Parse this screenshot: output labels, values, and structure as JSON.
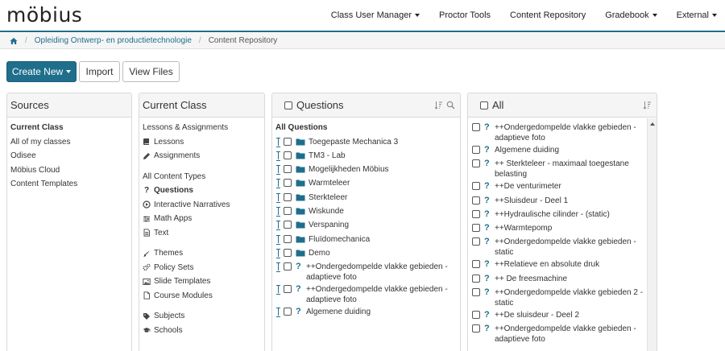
{
  "navbar": {
    "logo": "möbius",
    "items": [
      {
        "label": "Class User Manager",
        "dropdown": true
      },
      {
        "label": "Proctor Tools",
        "dropdown": false
      },
      {
        "label": "Content Repository",
        "dropdown": false
      },
      {
        "label": "Gradebook",
        "dropdown": true
      },
      {
        "label": "External",
        "dropdown": true
      }
    ]
  },
  "breadcrumb": {
    "home_icon": "home-icon",
    "course": "Opleiding Ontwerp- en productietechnologie",
    "current": "Content Repository"
  },
  "toolbar": {
    "create_new": "Create New",
    "import": "Import",
    "view_files": "View Files"
  },
  "sources": {
    "title": "Sources",
    "items": [
      "Current Class",
      "All of my classes",
      "Odisee",
      "Möbius Cloud",
      "Content Templates"
    ]
  },
  "current_class": {
    "title": "Current Class",
    "lessons_header": "Lessons & Assignments",
    "lessons": [
      {
        "label": "Lessons",
        "icon": "book-icon"
      },
      {
        "label": "Assignments",
        "icon": "pencil-icon"
      }
    ],
    "types_header": "All Content Types",
    "types": [
      {
        "label": "Questions",
        "icon": "question-icon"
      },
      {
        "label": "Interactive Narratives",
        "icon": "play-circle-icon"
      },
      {
        "label": "Math Apps",
        "icon": "sliders-icon"
      },
      {
        "label": "Text",
        "icon": "file-text-icon"
      }
    ],
    "misc": [
      {
        "label": "Themes",
        "icon": "brush-icon"
      },
      {
        "label": "Policy Sets",
        "icon": "gears-icon"
      },
      {
        "label": "Slide Templates",
        "icon": "image-icon"
      },
      {
        "label": "Course Modules",
        "icon": "document-icon"
      }
    ],
    "other": [
      {
        "label": "Subjects",
        "icon": "tag-icon"
      },
      {
        "label": "Schools",
        "icon": "graduation-cap-icon"
      }
    ]
  },
  "questions": {
    "title": "Questions",
    "header": "All Questions",
    "folders": [
      "Toegepaste Mechanica 3",
      "TM3 - Lab",
      "Mogelijkheden Möbius",
      "Warmteleer",
      "Sterkteleer",
      "Wiskunde",
      "Verspaning",
      "Fluïdomechanica",
      "Demo"
    ],
    "items": [
      "++Ondergedompelde vlakke gebieden - adaptieve foto",
      "++Ondergedompelde vlakke gebieden - adaptieve foto",
      "Algemene duiding"
    ]
  },
  "all": {
    "title": "All",
    "items": [
      "++Ondergedompelde vlakke gebieden - adaptieve foto",
      "Algemene duiding",
      "++ Sterkteleer - maximaal toegestane belasting",
      "++De venturimeter",
      "++Sluisdeur - Deel 1",
      "++Hydraulische cilinder - (static)",
      "++Warmtepomp",
      "++Ondergedompelde vlakke gebieden - static",
      "++Relatieve en absolute druk",
      "++ De freesmachine",
      "++Ondergedompelde vlakke gebieden 2 - static",
      "++De sluisdeur - Deel 2",
      "++Ondergedompelde vlakke gebieden - adaptieve foto"
    ]
  },
  "colors": {
    "accent": "#1f6e8c"
  }
}
